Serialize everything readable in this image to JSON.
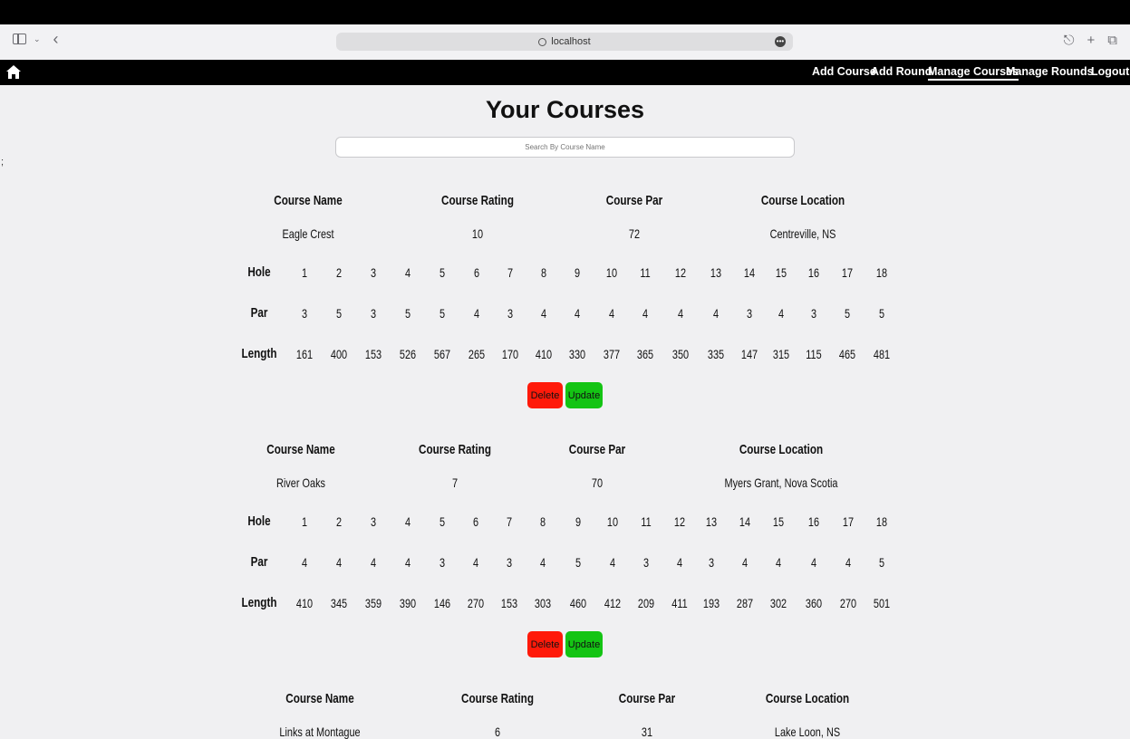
{
  "browser": {
    "url": "localhost"
  },
  "nav": {
    "links": [
      "Add Course",
      "Add Round",
      "Manage Courses",
      "Manage Rounds",
      "Logout"
    ],
    "active": "Manage Courses"
  },
  "stray_text": ";",
  "page": {
    "title": "Your Courses",
    "search_placeholder": "Search By Course Name"
  },
  "labels": {
    "course_name": "Course Name",
    "course_rating": "Course Rating",
    "course_par": "Course Par",
    "course_location": "Course Location",
    "hole": "Hole",
    "par": "Par",
    "length": "Length",
    "delete": "Delete",
    "update": "Update"
  },
  "holes": [
    "1",
    "2",
    "3",
    "4",
    "5",
    "6",
    "7",
    "8",
    "9",
    "10",
    "11",
    "12",
    "13",
    "14",
    "15",
    "16",
    "17",
    "18"
  ],
  "courses": [
    {
      "name": "Eagle Crest",
      "rating": "10",
      "par": "72",
      "location": "Centreville, NS",
      "hole_pars": [
        "3",
        "5",
        "3",
        "5",
        "5",
        "4",
        "3",
        "4",
        "4",
        "4",
        "4",
        "4",
        "4",
        "3",
        "4",
        "3",
        "5",
        "5"
      ],
      "hole_lengths": [
        "161",
        "400",
        "153",
        "526",
        "567",
        "265",
        "170",
        "410",
        "330",
        "377",
        "365",
        "350",
        "335",
        "147",
        "315",
        "115",
        "465",
        "481"
      ]
    },
    {
      "name": "River Oaks",
      "rating": "7",
      "par": "70",
      "location": "Myers Grant, Nova Scotia",
      "hole_pars": [
        "4",
        "4",
        "4",
        "4",
        "3",
        "4",
        "3",
        "4",
        "5",
        "4",
        "3",
        "4",
        "3",
        "4",
        "4",
        "4",
        "4",
        "5"
      ],
      "hole_lengths": [
        "410",
        "345",
        "359",
        "390",
        "146",
        "270",
        "153",
        "303",
        "460",
        "412",
        "209",
        "411",
        "193",
        "287",
        "302",
        "360",
        "270",
        "501"
      ]
    },
    {
      "name": "Links at Montague",
      "rating": "6",
      "par": "31",
      "location": "Lake Loon, NS"
    }
  ]
}
